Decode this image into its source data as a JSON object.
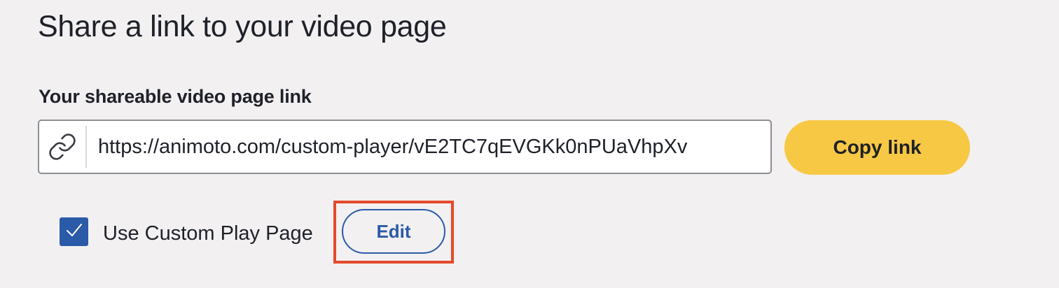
{
  "header": {
    "title": "Share a link to your video page"
  },
  "share": {
    "label": "Your shareable video page link",
    "link_value": "https://animoto.com/custom-player/vE2TC7qEVGKk0nPUaVhpXv",
    "link_icon": "link-icon",
    "copy_label": "Copy link"
  },
  "custom_play_page": {
    "checked": true,
    "label": "Use Custom Play Page",
    "edit_label": "Edit"
  },
  "colors": {
    "background": "#f2f0f1",
    "accent_yellow": "#f7c844",
    "accent_blue": "#2a5aa8",
    "highlight_red": "#e34a2c"
  }
}
